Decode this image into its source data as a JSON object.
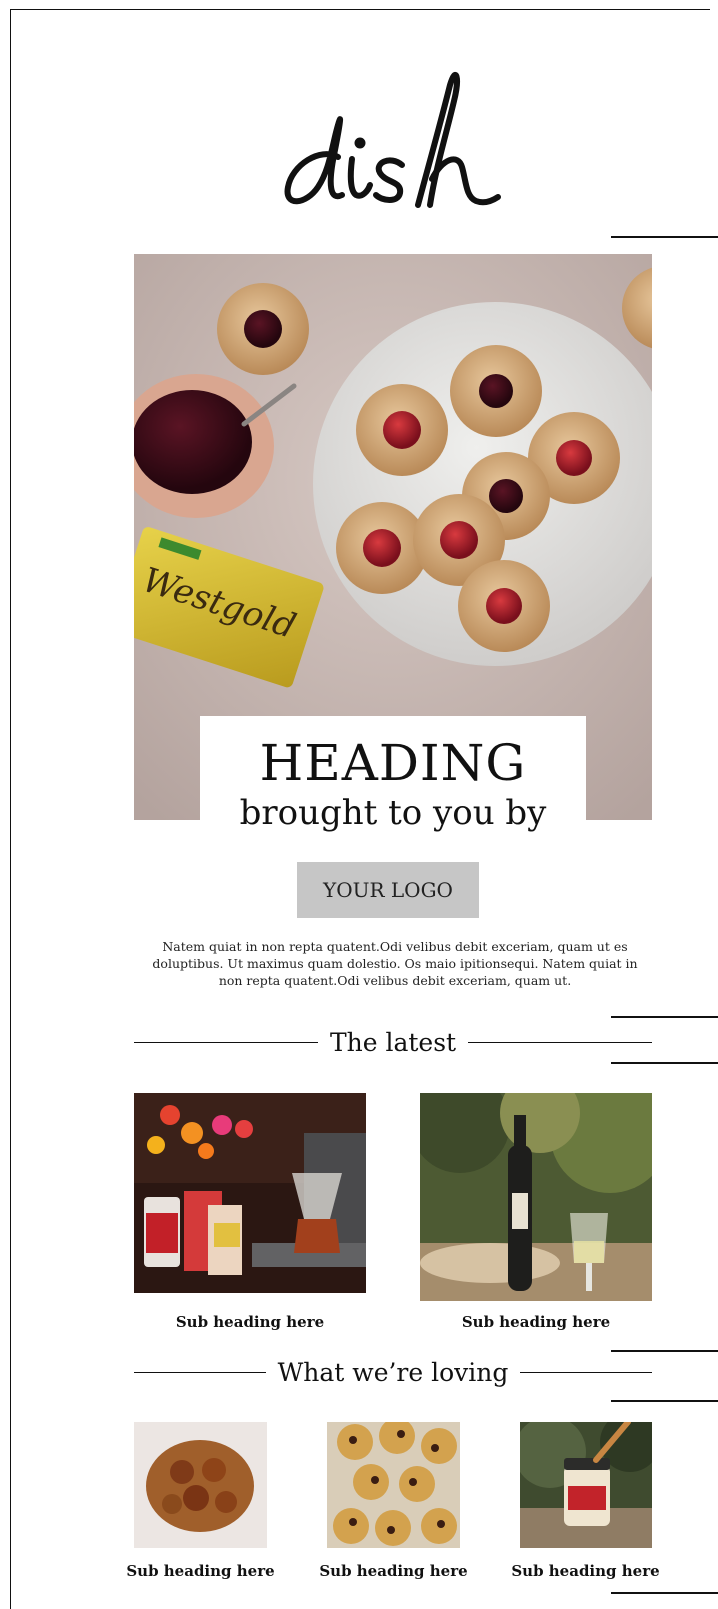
{
  "brand": {
    "logo_text": "dish"
  },
  "hero": {
    "heading": "HEADING",
    "subheading": "brought to you by",
    "sponsor_logo": "YOUR LOGO",
    "package_label": "Westgold"
  },
  "intro_text": "Natem quiat in non repta quatent.Odi velibus debit exceriam, quam ut es doluptibus. Ut maximus quam dolestio. Os maio ipitionsequi. Natem quiat in non repta quatent.Odi velibus debit exceriam, quam ut.",
  "latest": {
    "title": "The latest",
    "items": [
      {
        "caption": "Sub heading here"
      },
      {
        "caption": "Sub heading here"
      }
    ]
  },
  "loving": {
    "title": "What we’re loving",
    "items": [
      {
        "caption": "Sub heading here"
      },
      {
        "caption": "Sub heading here"
      },
      {
        "caption": "Sub heading here"
      }
    ]
  }
}
